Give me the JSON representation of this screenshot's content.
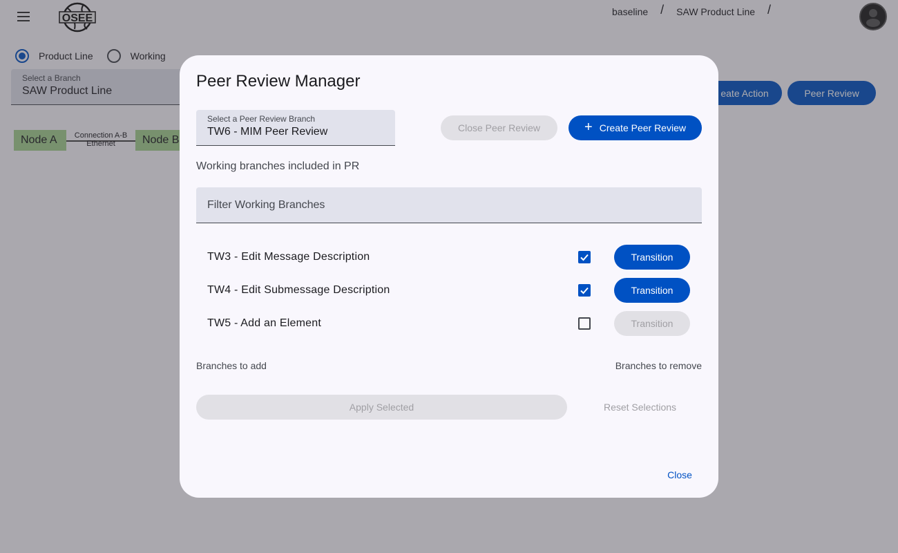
{
  "header": {
    "logo_text": "OSEE",
    "breadcrumb": [
      "baseline",
      "SAW Product Line"
    ],
    "breadcrumb_separator": "/"
  },
  "branch_type": {
    "options": [
      {
        "label": "Product Line",
        "checked": true
      },
      {
        "label": "Working",
        "checked": false
      }
    ]
  },
  "branch_select": {
    "label": "Select a Branch",
    "value": "SAW Product Line"
  },
  "toolbar": {
    "create_action_label": "Create Action",
    "create_action_visible_text": "eate Action",
    "peer_review_label": "Peer Review"
  },
  "diagram": {
    "node_a": "Node A",
    "node_b": "Node B",
    "connection_name": "Connection A-B",
    "connection_type": "Ethernet"
  },
  "dialog": {
    "title": "Peer Review Manager",
    "pr_select": {
      "label": "Select a Peer Review Branch",
      "value": "TW6 - MIM Peer Review"
    },
    "close_pr_label": "Close Peer Review",
    "create_pr_label": "Create Peer Review",
    "create_pr_icon": "+",
    "section_label": "Working branches included in PR",
    "filter_placeholder": "Filter Working Branches",
    "branches": [
      {
        "name": "TW3 - Edit Message Description",
        "checked": true,
        "transition_label": "Transition",
        "transition_enabled": true
      },
      {
        "name": "TW4 - Edit Submessage Description",
        "checked": true,
        "transition_label": "Transition",
        "transition_enabled": true
      },
      {
        "name": "TW5 - Add an Element",
        "checked": false,
        "transition_label": "Transition",
        "transition_enabled": false
      }
    ],
    "branches_to_add_label": "Branches to add",
    "branches_to_remove_label": "Branches to remove",
    "apply_label": "Apply Selected",
    "reset_label": "Reset Selections",
    "close_label": "Close"
  },
  "colors": {
    "primary": "#0051c3",
    "node_fill": "#a4d18f",
    "disabled_bg": "#e1e0e5",
    "disabled_text": "#a09fa4",
    "dialog_bg": "#f9f7fd"
  }
}
